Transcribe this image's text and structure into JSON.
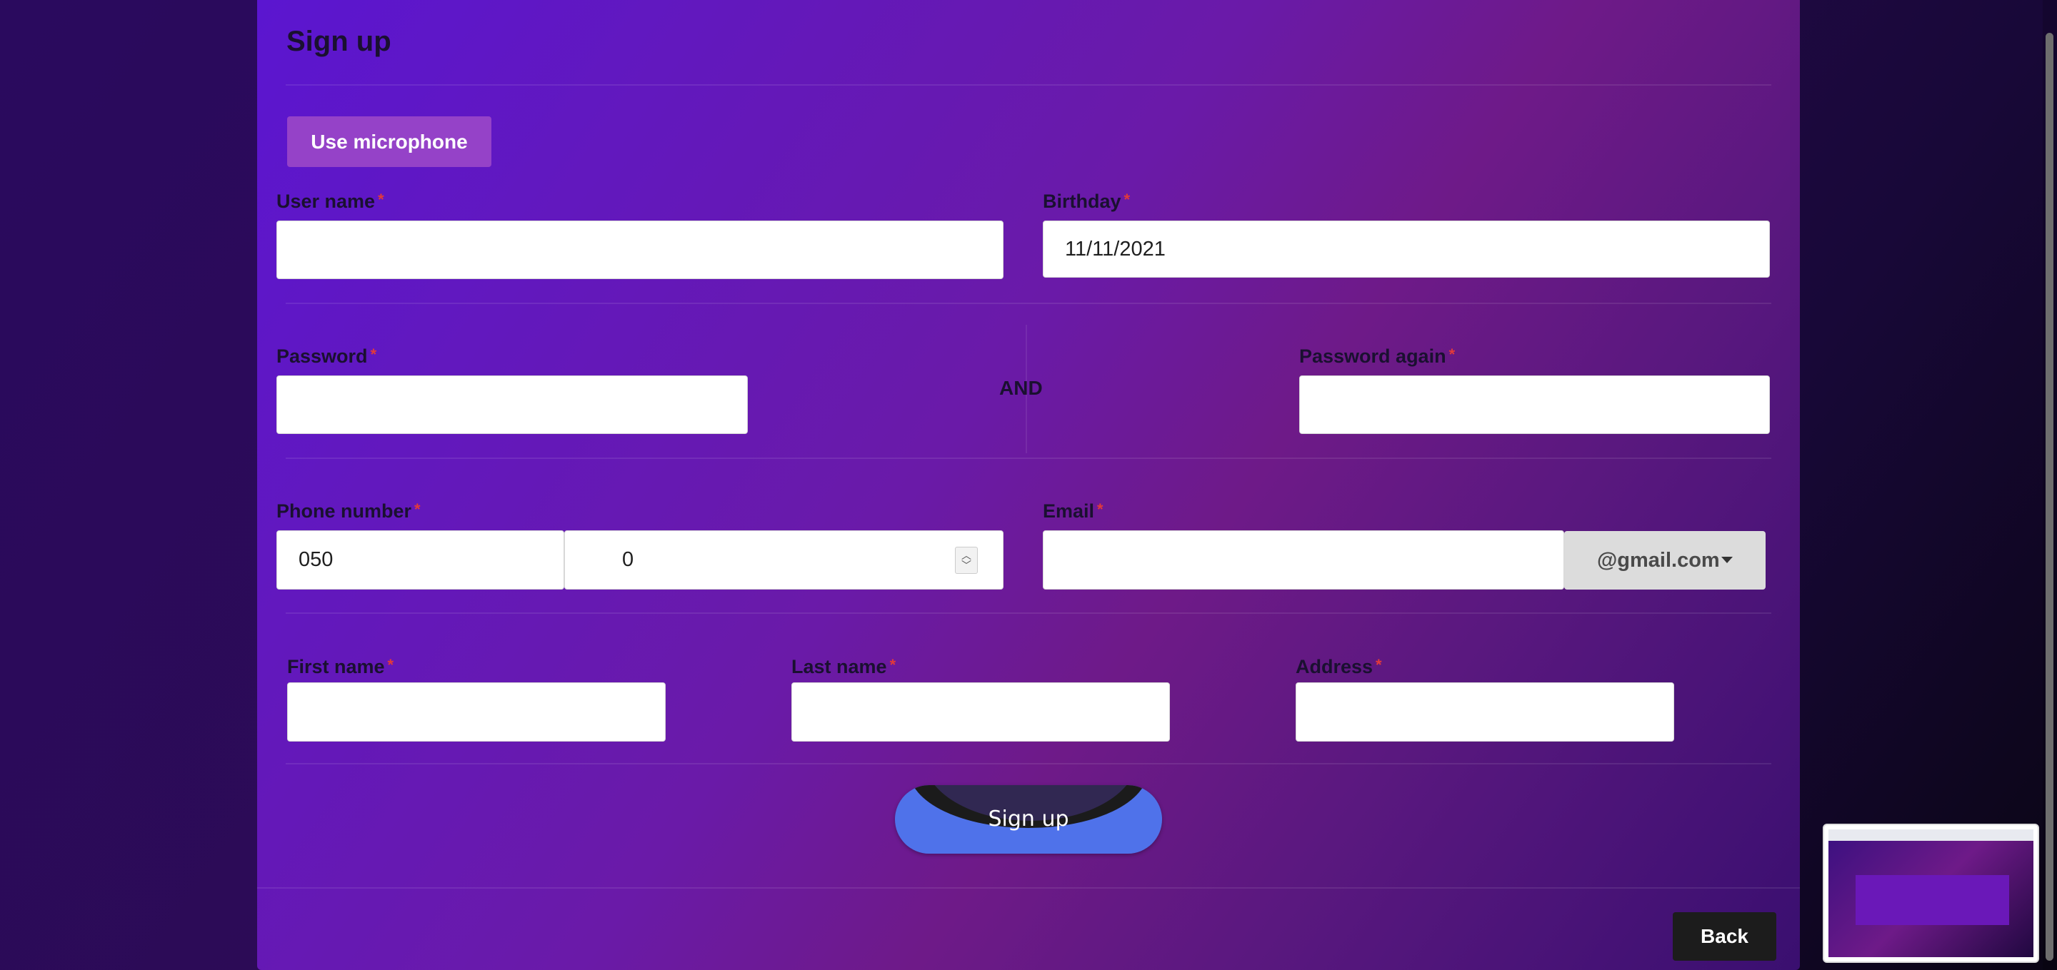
{
  "form": {
    "title": "Sign up",
    "mic_button": "Use microphone",
    "required_mark": "*",
    "username": {
      "label": "User name",
      "value": ""
    },
    "birthday": {
      "label": "Birthday",
      "value": "11/11/2021"
    },
    "password": {
      "label": "Password",
      "value": ""
    },
    "separator": "AND",
    "password_again": {
      "label": "Password again",
      "value": ""
    },
    "phone": {
      "label": "Phone number",
      "prefix": "050",
      "number": "0"
    },
    "email": {
      "label": "Email",
      "value": "",
      "domain": "@gmail.com"
    },
    "first_name": {
      "label": "First name",
      "value": ""
    },
    "last_name": {
      "label": "Last name",
      "value": ""
    },
    "address": {
      "label": "Address",
      "value": ""
    },
    "submit": "Sign up"
  },
  "footer": {
    "back": "Back"
  },
  "colors": {
    "card_gradient_start": "#5b16d0",
    "card_gradient_end": "#6e1a88",
    "mic_button": "#9542c8",
    "required": "#e23a3a",
    "submit_blue": "#4f72ea",
    "back_button": "#1c1c1c"
  },
  "icons": {
    "dropdown": "chevron-down-icon",
    "spinner": "number-spinner-icon"
  }
}
